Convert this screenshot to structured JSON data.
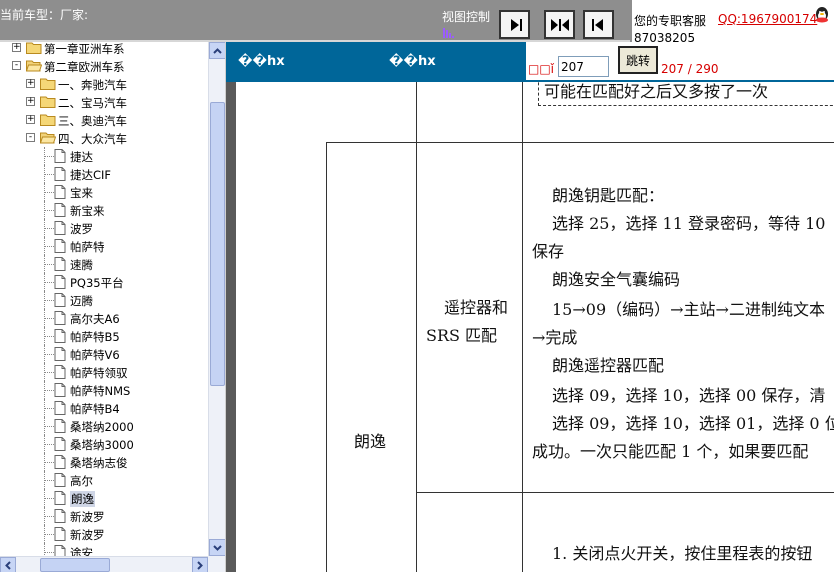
{
  "toolbar": {
    "car_type_label": "当前车型：厂家:",
    "view_control_label": "视图控制",
    "view_buttons": [
      "left-panel-toggle",
      "split-view",
      "right-panel-toggle"
    ]
  },
  "service": {
    "label": "您的专职客服",
    "qq": "QQ:1967900174",
    "phone": "87038205"
  },
  "tree": {
    "items": [
      {
        "level": 0,
        "type": "folder",
        "expander": "+",
        "label": "第一章亚洲车系"
      },
      {
        "level": 0,
        "type": "folder-open",
        "expander": "-",
        "label": "第二章欧洲车系"
      },
      {
        "level": 1,
        "type": "folder",
        "expander": "+",
        "label": "一、奔驰汽车"
      },
      {
        "level": 1,
        "type": "folder",
        "expander": "+",
        "label": "二、宝马汽车"
      },
      {
        "level": 1,
        "type": "folder",
        "expander": "+",
        "label": "三、奥迪汽车"
      },
      {
        "level": 1,
        "type": "folder-open",
        "expander": "-",
        "label": "四、大众汽车"
      },
      {
        "level": 2,
        "type": "page",
        "label": "捷达"
      },
      {
        "level": 2,
        "type": "page",
        "label": "捷达CIF"
      },
      {
        "level": 2,
        "type": "page",
        "label": "宝来"
      },
      {
        "level": 2,
        "type": "page",
        "label": "新宝来"
      },
      {
        "level": 2,
        "type": "page",
        "label": "波罗"
      },
      {
        "level": 2,
        "type": "page",
        "label": "帕萨特"
      },
      {
        "level": 2,
        "type": "page",
        "label": "速腾"
      },
      {
        "level": 2,
        "type": "page",
        "label": "PQ35平台"
      },
      {
        "level": 2,
        "type": "page",
        "label": "迈腾"
      },
      {
        "level": 2,
        "type": "page",
        "label": "高尔夫A6"
      },
      {
        "level": 2,
        "type": "page",
        "label": "帕萨特B5"
      },
      {
        "level": 2,
        "type": "page",
        "label": "帕萨特V6"
      },
      {
        "level": 2,
        "type": "page",
        "label": "帕萨特领驭"
      },
      {
        "level": 2,
        "type": "page",
        "label": "帕萨特NMS"
      },
      {
        "level": 2,
        "type": "page",
        "label": "帕萨特B4"
      },
      {
        "level": 2,
        "type": "page",
        "label": "桑塔纳2000"
      },
      {
        "level": 2,
        "type": "page",
        "label": "桑塔纳3000"
      },
      {
        "level": 2,
        "type": "page",
        "label": "桑塔纳志俊"
      },
      {
        "level": 2,
        "type": "page",
        "label": "高尔"
      },
      {
        "level": 2,
        "type": "page",
        "label": "朗逸",
        "selected": true
      },
      {
        "level": 2,
        "type": "page",
        "label": "新波罗"
      },
      {
        "level": 2,
        "type": "page",
        "label": "新波罗"
      },
      {
        "level": 2,
        "type": "page",
        "label": "途安"
      }
    ]
  },
  "content": {
    "bar_label_1": "��hx",
    "bar_label_2": "��hx",
    "pager": {
      "prefix": "□□ǐ",
      "page_input": "207",
      "go_label": "跳转",
      "page_count": "207 / 290"
    }
  },
  "document": {
    "top_text": "可能在匹配好之后又多按了一次",
    "model": "朗逸",
    "function_line1": "遥控器和",
    "function_line2": "SRS 匹配",
    "lines": [
      "朗逸钥匙匹配：",
      "选择 25，选择 11 登录密码，等待 10",
      "保存",
      "朗逸安全气囊编码",
      "15→09（编码）→主站→二进制纯文本",
      "→完成",
      "朗逸遥控器匹配",
      "选择 09，选择 10，选择 00 保存，清",
      "选择 09，选择 10，选择 01，选择 0 位",
      "成功。一次只能匹配 1 个，如果要匹配"
    ],
    "bottom_line": "1. 关闭点火开关，按住里程表的按钮"
  }
}
